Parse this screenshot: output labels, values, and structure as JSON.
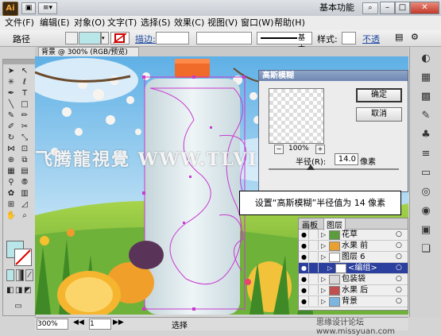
{
  "app": {
    "logo": "Ai",
    "title_btn1": "▣",
    "title_btn2": "≡▾"
  },
  "workspace": {
    "label": "基本功能",
    "arrow": "▾"
  },
  "window_controls": {
    "min": "–",
    "max": "□",
    "close": "✕"
  },
  "menu": [
    "文件(F)",
    "编辑(E)",
    "对象(O)",
    "文字(T)",
    "选择(S)",
    "效果(C)",
    "视图(V)",
    "窗口(W)",
    "帮助(H)"
  ],
  "control": {
    "path_label": "路径",
    "stroke_label": "描边:",
    "basic": "基本",
    "style_label": "样式:",
    "opacity_label": "不透"
  },
  "document_tab": {
    "label": "背景 @ 300% (RGB/预览)",
    "close": "✕"
  },
  "dialog": {
    "title": "高斯模糊",
    "ok": "确定",
    "cancel": "取消",
    "zoom": "100%",
    "radius_label": "半径(R):",
    "radius_value": "14.0",
    "unit": "像素"
  },
  "callout": {
    "text": "设置“高斯模糊”半径值为 14 像素"
  },
  "layers_panel": {
    "tabs": [
      "画板",
      "图层"
    ],
    "rows": [
      {
        "name": "花草",
        "indent": 0,
        "thumb": "#5c9c3a"
      },
      {
        "name": "水果 前",
        "indent": 0,
        "thumb": "#e8a030"
      },
      {
        "name": "图层 6",
        "indent": 0,
        "thumb": "#ffffff"
      },
      {
        "name": "<编组>",
        "indent": 1,
        "thumb": "#ffffff",
        "selected": true
      },
      {
        "name": "包装袋",
        "indent": 0,
        "thumb": "#d9d9d9"
      },
      {
        "name": "水果 后",
        "indent": 0,
        "thumb": "#c05050"
      },
      {
        "name": "背景",
        "indent": 0,
        "thumb": "#7bb6e0"
      }
    ]
  },
  "status": {
    "zoom": "300%",
    "page": "1",
    "tool": "选择"
  },
  "watermark": {
    "main": "飞腾龍視覺 WWW.TLVI.NET",
    "bottom": "思缘设计论坛 www.missyuan.com"
  },
  "colors": {
    "selection": "#c83ad0",
    "fill_swatch": "#b9e6e8",
    "dialog_title": "#7088b3",
    "layer_selected": "#2b3f9e"
  }
}
